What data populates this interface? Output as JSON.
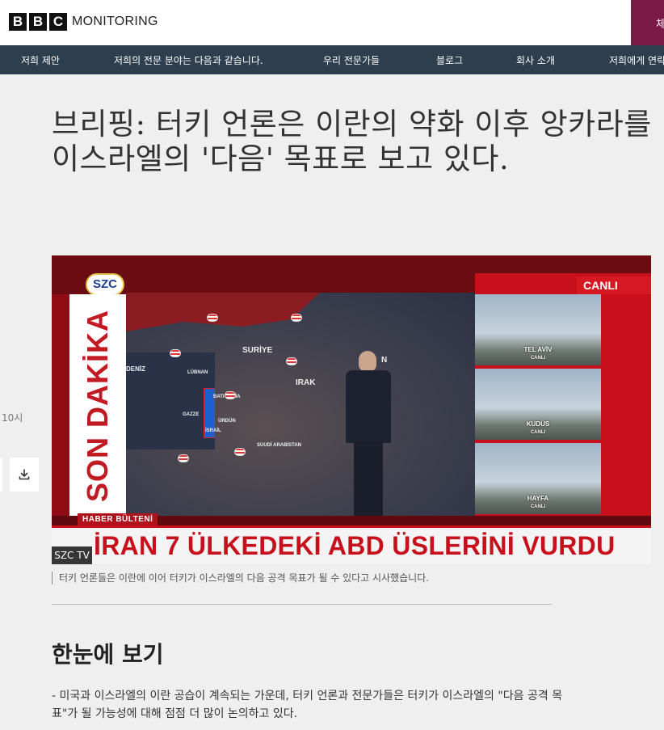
{
  "header": {
    "brand_letters": [
      "B",
      "B",
      "C"
    ],
    "brand_name": "MONITORING",
    "cta_label": "체"
  },
  "nav": {
    "items": [
      {
        "label": "저희 제안"
      },
      {
        "label": "저희의 전문 분야는 다음과 같습니다."
      },
      {
        "label": "우리 전문가들"
      },
      {
        "label": "블로그"
      },
      {
        "label": "회사 소개"
      },
      {
        "label": "저희에게 연락"
      }
    ]
  },
  "article": {
    "title": "브리핑: 터키 언론은 이란의 약화 이후 앙카라를 이스라엘의 '다음' 목표로 보고 있다.",
    "time_fragment": "10시",
    "download_icon": "download-icon",
    "caption": "터키 언론들은 이란에 이어 터키가 이스라엘의 다음 공격 목표가 될 수 있다고 시사했습니다.",
    "section_heading": "한눈에 보기",
    "summary": "- 미국과 이스라엘의 이란 공습이 계속되는 가운데, 터키 언론과 전문가들은 터키가 이스라엘의 \"다음 공격 목표\"가 될 가능성에 대해 점점 더 많이 논의하고 있다."
  },
  "image": {
    "channel_logo": "SZC",
    "vertical_banner": "SON DAKİKA",
    "live_label": "CANLI",
    "map_labels": {
      "deniz": "DENİZ",
      "suriye": "SURİYE",
      "lubnan": "LÜBNAN",
      "irak": "IRAK",
      "bati_seria": "BATI ŞERİA",
      "gazze": "GAZZE",
      "israil": "İSRAİL",
      "urdun": "ÜRDÜN",
      "suudi": "SUUDİ ARABİSTAN",
      "iran_partial": "N"
    },
    "cams": [
      {
        "city": "TEL AVİV",
        "status": "CANLI"
      },
      {
        "city": "KUDÜS",
        "status": "CANLI"
      },
      {
        "city": "HAYFA",
        "status": "CANLI"
      }
    ],
    "bulletin_label": "HABER BÜLTENİ",
    "ticker": "İRAN 7 ÜLKEDEKİ ABD ÜSLERİNİ VURDU",
    "credit": "SZC TV"
  },
  "colors": {
    "nav_bg": "#2d3e4f",
    "cta_bg": "#7a1a45",
    "page_bg": "#efefef",
    "tv_red": "#c8101c"
  }
}
